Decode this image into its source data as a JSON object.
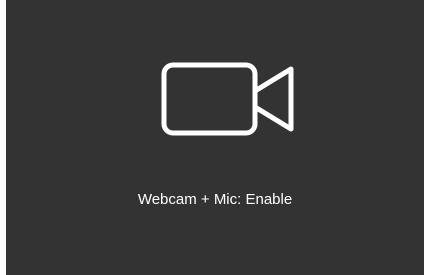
{
  "webcam_prompt": {
    "icon": "video-camera-icon",
    "label": "Webcam + Mic: Enable"
  },
  "colors": {
    "panel_background": "#333333",
    "foreground": "#ffffff"
  }
}
